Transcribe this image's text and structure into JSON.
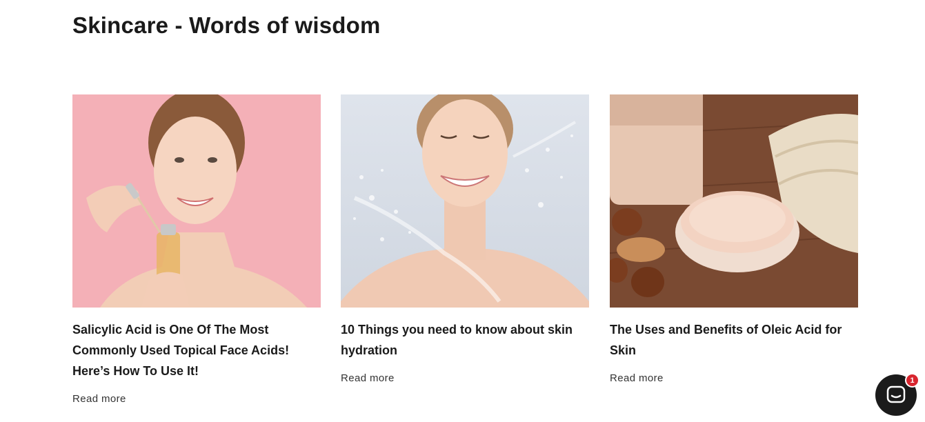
{
  "section": {
    "title": "Skincare - Words of wisdom"
  },
  "articles": [
    {
      "title": "Salicylic Acid is One Of The Most Commonly Used Topical Face Acids! Here’s How To Use It!",
      "read_more": "Read more",
      "image_icon": "woman-with-serum-dropper-image"
    },
    {
      "title": "10 Things you need to know about skin hydration",
      "read_more": "Read more",
      "image_icon": "woman-water-splash-image"
    },
    {
      "title": "The Uses and Benefits of Oleic Acid for Skin",
      "read_more": "Read more",
      "image_icon": "scrub-jars-hazelnuts-image"
    }
  ],
  "chat": {
    "badge_count": "1",
    "icon": "chat-bubble-icon"
  },
  "colors": {
    "text": "#1a1a1a",
    "chat_button": "#1b1b1b",
    "badge": "#d8262f"
  }
}
